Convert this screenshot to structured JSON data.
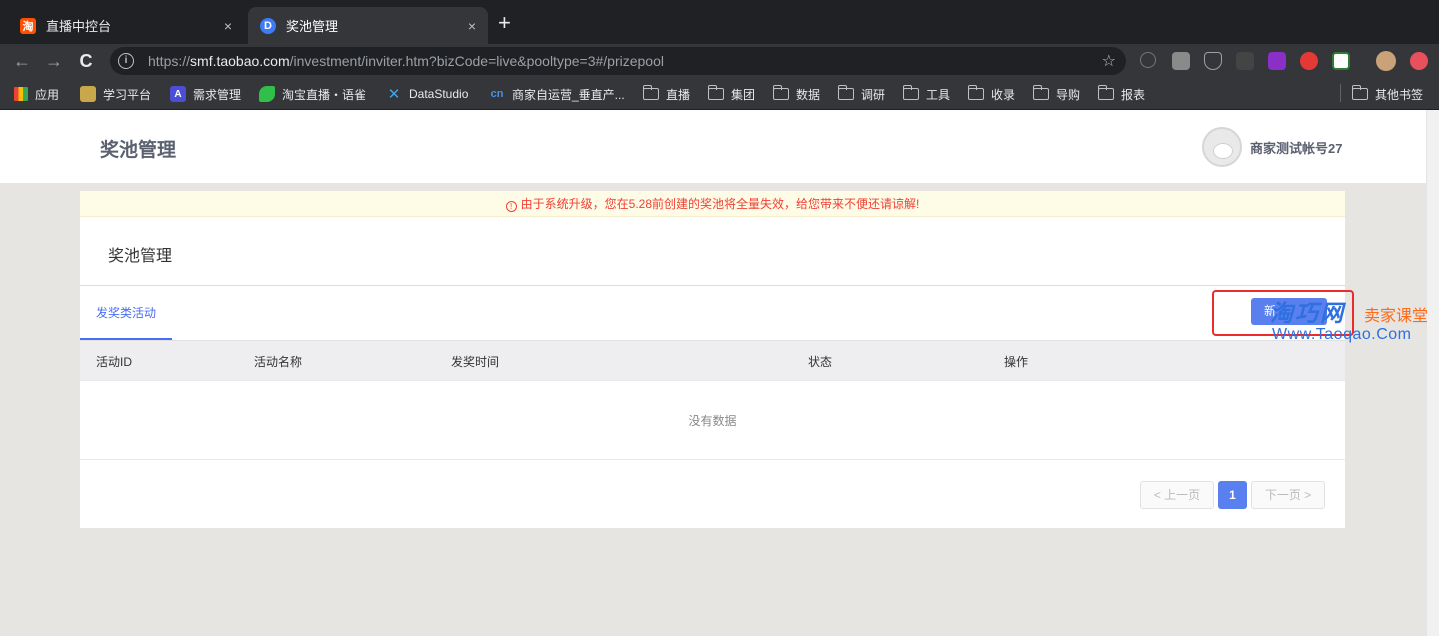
{
  "browser": {
    "tabs": [
      {
        "title": "直播中控台",
        "active": false,
        "favicon": "淘"
      },
      {
        "title": "奖池管理",
        "active": true,
        "favicon": "D"
      }
    ],
    "close_glyph": "×",
    "new_tab_glyph": "+",
    "url": {
      "scheme": "https://",
      "host": "smf.taobao.com",
      "path": "/investment/inviter.htm?bizCode=live&pooltype=3#/prizepool"
    },
    "nav": {
      "back": "←",
      "forward": "→",
      "reload": "C"
    },
    "bookmarks": [
      {
        "label": "应用",
        "icon": "apps-grid-icon"
      },
      {
        "label": "学习平台",
        "icon": "study-icon"
      },
      {
        "label": "需求管理",
        "icon": "A"
      },
      {
        "label": "淘宝直播・语雀",
        "icon": "yuque-icon"
      },
      {
        "label": "DataStudio",
        "icon": "datastudio-icon"
      },
      {
        "label": "商家自运营_垂直产...",
        "icon": "cn-icon"
      },
      {
        "label": "直播",
        "icon": "folder-icon"
      },
      {
        "label": "集团",
        "icon": "folder-icon"
      },
      {
        "label": "数据",
        "icon": "folder-icon"
      },
      {
        "label": "调研",
        "icon": "folder-icon"
      },
      {
        "label": "工具",
        "icon": "folder-icon"
      },
      {
        "label": "收录",
        "icon": "folder-icon"
      },
      {
        "label": "导购",
        "icon": "folder-icon"
      },
      {
        "label": "报表",
        "icon": "folder-icon"
      }
    ],
    "other_bookmarks": "其他书签",
    "colors": {
      "tabbar": "#202124",
      "toolbar": "#35363a"
    }
  },
  "header": {
    "title": "奖池管理",
    "username": "商家测试帐号27"
  },
  "notice": {
    "text": "由于系统升级，您在5.28前创建的奖池将全量失效，给您带来不便还请谅解!",
    "icon_glyph": "!"
  },
  "main": {
    "section_title": "奖池管理",
    "tab_label": "发奖类活动",
    "create_button": "新",
    "columns": [
      "活动ID",
      "活动名称",
      "发奖时间",
      "状态",
      "操作"
    ],
    "empty_text": "没有数据",
    "pagination": {
      "prev": "< 上一页",
      "current": "1",
      "next": "下一页 >"
    },
    "accent_color": "#5a80f0"
  },
  "watermark": {
    "brand": "淘巧网",
    "tagline": "卖家课堂",
    "site": "Www.Taoqao.Com"
  }
}
